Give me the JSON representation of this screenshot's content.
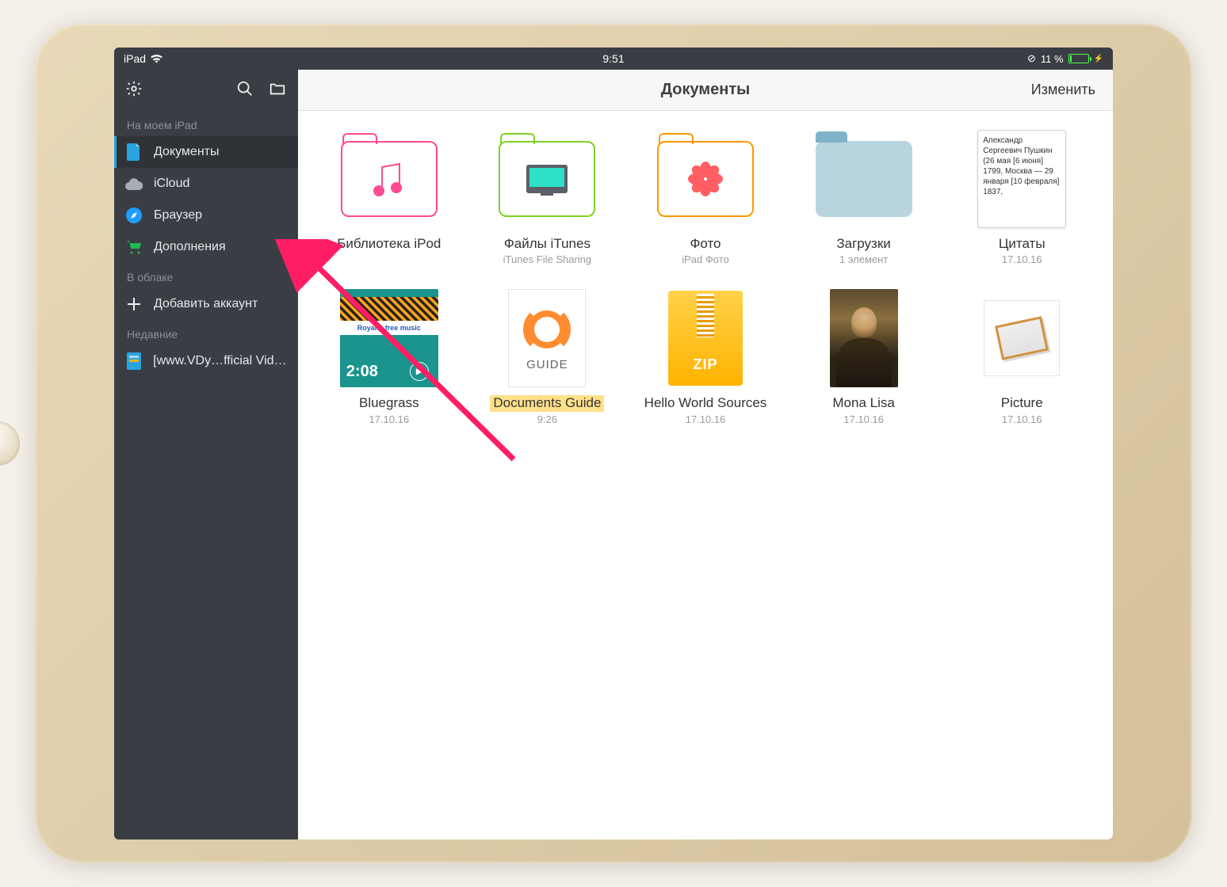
{
  "statusbar": {
    "device": "iPad",
    "time": "9:51",
    "battery": "11 %"
  },
  "sidebar": {
    "sections": [
      {
        "head": "На моем iPad",
        "items": [
          {
            "label": "Документы",
            "icon": "doc-icon",
            "color": "#2aa4de",
            "selected": true
          },
          {
            "label": "iCloud",
            "icon": "cloud-icon",
            "color": "#a7adb5"
          },
          {
            "label": "Браузер",
            "icon": "compass-icon",
            "color": "#1e9cff"
          },
          {
            "label": "Дополнения",
            "icon": "cart-icon",
            "color": "#1db954"
          }
        ]
      },
      {
        "head": "В облаке",
        "items": [
          {
            "label": "Добавить аккаунт",
            "icon": "plus-icon",
            "color": "#eee"
          }
        ]
      },
      {
        "head": "Недавние",
        "items": [
          {
            "label": "[www.VDy…fficial Video)",
            "icon": "file-icon",
            "color": "#2aa4de"
          }
        ]
      }
    ]
  },
  "main": {
    "title": "Документы",
    "action": "Изменить",
    "items": [
      {
        "kind": "folder",
        "style": "pink",
        "title": "Библиотека iPod",
        "sub": ""
      },
      {
        "kind": "folder",
        "style": "green",
        "title": "Файлы iTunes",
        "sub": "iTunes File Sharing"
      },
      {
        "kind": "folder",
        "style": "orange",
        "title": "Фото",
        "sub": "iPad Фото"
      },
      {
        "kind": "folder",
        "style": "blue",
        "title": "Загрузки",
        "sub": "1 элемент"
      },
      {
        "kind": "textdoc",
        "title": "Цитаты",
        "date": "17.10.16",
        "preview": "Александр Сергеевич Пушкин (26 мая [6 июня] 1799, Москва — 29 января [10 февраля] 1837,"
      },
      {
        "kind": "video",
        "title": "Bluegrass",
        "date": "17.10.16",
        "duration": "2:08",
        "overlay": "Royalty free music"
      },
      {
        "kind": "guide",
        "title": "Documents Guide",
        "date": "9:26",
        "highlighted": true,
        "guide_label": "GUIDE"
      },
      {
        "kind": "zip",
        "title": "Hello World Sources",
        "date": "17.10.16",
        "zip_label": "ZIP"
      },
      {
        "kind": "mona",
        "title": "Mona Lisa",
        "date": "17.10.16"
      },
      {
        "kind": "picture",
        "title": "Picture",
        "date": "17.10.16"
      }
    ]
  }
}
